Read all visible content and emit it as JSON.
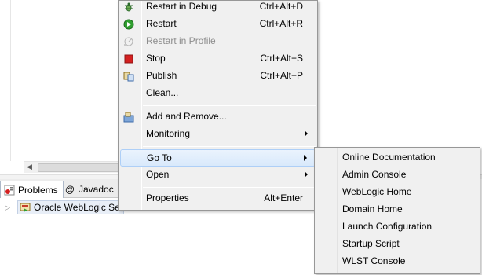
{
  "context_menu": {
    "items": [
      {
        "label": "Restart in Debug",
        "shortcut": "Ctrl+Alt+D",
        "icon": "debug-bug-icon"
      },
      {
        "label": "Restart",
        "shortcut": "Ctrl+Alt+R",
        "icon": "run-icon"
      },
      {
        "label": "Restart in Profile",
        "shortcut": "",
        "icon": "profile-icon",
        "disabled": true
      },
      {
        "label": "Stop",
        "shortcut": "Ctrl+Alt+S",
        "icon": "stop-icon"
      },
      {
        "label": "Publish",
        "shortcut": "Ctrl+Alt+P",
        "icon": "publish-icon"
      },
      {
        "label": "Clean...",
        "shortcut": ""
      },
      {
        "label": "Add and Remove...",
        "shortcut": "",
        "icon": "add-remove-icon"
      },
      {
        "label": "Monitoring",
        "submenu": true
      },
      {
        "label": "Go To",
        "submenu": true,
        "highlighted": true
      },
      {
        "label": "Open",
        "submenu": true
      },
      {
        "label": "Properties",
        "shortcut": "Alt+Enter"
      }
    ]
  },
  "goto_submenu": {
    "items": [
      "Online Documentation",
      "Admin Console",
      "WebLogic Home",
      "Domain Home",
      "Launch Configuration",
      "Startup Script",
      "WLST Console"
    ]
  },
  "view_tabs": {
    "problems": "Problems",
    "javadoc": "Javadoc"
  },
  "servers": {
    "row_label": "Oracle WebLogic Se"
  },
  "colors": {
    "menu_bg": "#f0f0f0",
    "highlight": "#d9e9fb",
    "stop_red": "#d42020",
    "run_green": "#2f9e2f"
  }
}
